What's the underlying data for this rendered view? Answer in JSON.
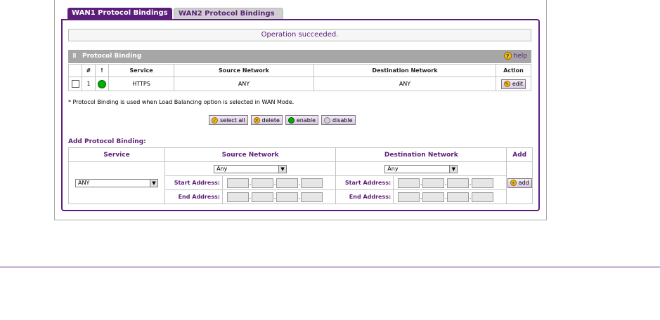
{
  "tabs": [
    {
      "label": "WAN1 Protocol Bindings",
      "active": true
    },
    {
      "label": "WAN2 Protocol Bindings",
      "active": false
    }
  ],
  "status_message": "Operation succeeded.",
  "section": {
    "title": "Protocol Binding",
    "help_label": "help"
  },
  "binding_table": {
    "headers": [
      "#",
      "!",
      "Service",
      "Source Network",
      "Destination Network",
      "Action"
    ],
    "rows": [
      {
        "index": "1",
        "service": "HTTPS",
        "source": "ANY",
        "destination": "ANY",
        "action_label": "edit"
      }
    ]
  },
  "note": "* Protocol Binding is used when Load Balancing option is selected in WAN Mode.",
  "actions": {
    "select_all": "select all",
    "delete": "delete",
    "enable": "enable",
    "disable": "disable"
  },
  "add_binding": {
    "title": "Add Protocol Binding:",
    "headers": {
      "service": "Service",
      "source": "Source Network",
      "destination": "Destination Network",
      "add": "Add"
    },
    "service_value": "ANY",
    "source_select": "Any",
    "destination_select": "Any",
    "start_label": "Start Address:",
    "end_label": "End Address:",
    "add_label": "add"
  },
  "colors": {
    "accent": "#5b1f7b",
    "status_enabled": "#00b000"
  }
}
